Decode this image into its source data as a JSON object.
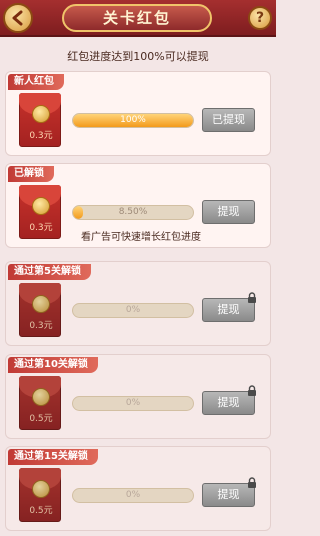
{
  "header": {
    "title": "关卡红包",
    "help": "?"
  },
  "progress_note": "红包进度达到100%可以提现",
  "cards": [
    {
      "tag": "新人红包",
      "amount": "0.3元",
      "progress_label": "100%",
      "progress": 1.0,
      "button": "已提现",
      "note": ""
    },
    {
      "tag": "已解锁",
      "amount": "0.3元",
      "progress_label": "8.50%",
      "progress": 0.085,
      "button": "提现",
      "note": "看广告可快速增长红包进度"
    },
    {
      "tag": "通过第5关解锁",
      "amount": "0.3元",
      "progress_label": "0%",
      "progress": 0,
      "button": "提现",
      "note": ""
    },
    {
      "tag": "通过第10关解锁",
      "amount": "0.5元",
      "progress_label": "0%",
      "progress": 0,
      "button": "提现",
      "note": ""
    },
    {
      "tag": "通过第15关解锁",
      "amount": "0.5元",
      "progress_label": "0%",
      "progress": 0,
      "button": "提现",
      "note": ""
    }
  ]
}
